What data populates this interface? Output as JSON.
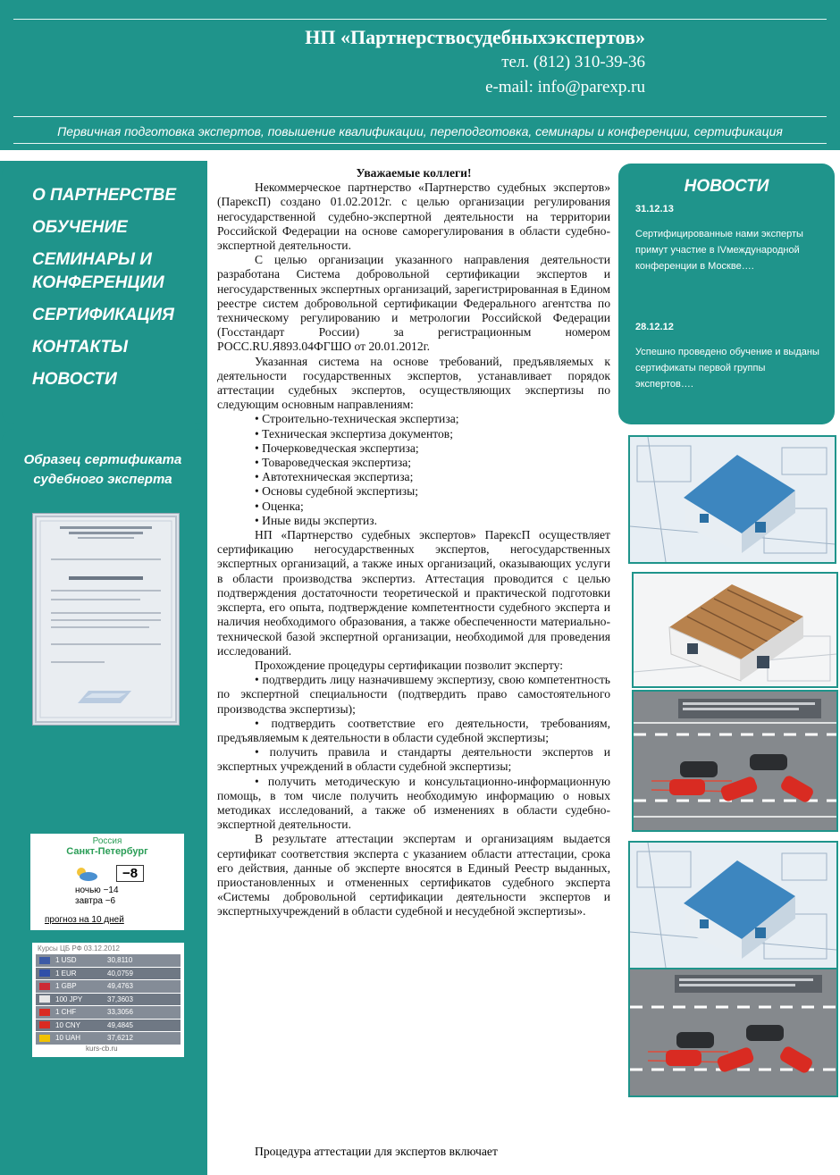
{
  "header": {
    "title": "НП «Партнерствосудебныхэкспертов»",
    "phone": "тел. (812) 310-39-36",
    "email": "e-mail: info@parexp.ru",
    "tagline": "Первичная подготовка экспертов, повышение квалификации, переподготовка, семинары и конференции, сертификация"
  },
  "nav": {
    "items": [
      "О ПАРТНЕРСТВЕ",
      "ОБУЧЕНИЕ",
      "СЕМИНАРЫ И КОНФЕРЕНЦИИ",
      "СЕРТИФИКАЦИЯ",
      "КОНТАКТЫ",
      "НОВОСТИ"
    ]
  },
  "sidebar": {
    "cert_heading": "Образец сертификата судебного эксперта"
  },
  "weather": {
    "country": "Россия",
    "city": "Санкт-Петербург",
    "temp": "−8",
    "night": "ночью −14",
    "tomorrow": "завтра −6",
    "forecast_link": "прогноз на 10 дней"
  },
  "currency": {
    "header": "Курсы ЦБ РФ 03.12.2012",
    "rows": [
      {
        "name": "1 USD",
        "value": "30,8110"
      },
      {
        "name": "1 EUR",
        "value": "40,0759"
      },
      {
        "name": "1 GBP",
        "value": "49,4763"
      },
      {
        "name": "100 JPY",
        "value": "37,3603"
      },
      {
        "name": "1 CHF",
        "value": "33,3056"
      },
      {
        "name": "10 CNY",
        "value": "49,4845"
      },
      {
        "name": "10 UAH",
        "value": "37,6212"
      }
    ],
    "footer": "kurs-cb.ru"
  },
  "content": {
    "greeting": "Уважаемые коллеги!",
    "p1": "Некоммерческое партнерство «Партнерство судебных экспертов» (ПарексП) создано 01.02.2012г. с целью организации регулирования негосударственной судебно-экспертной деятельности на территории Российской Федерации на основе саморегулирования в области судебно-экспертной деятельности.",
    "p2": "С целью организации указанного направления деятельности разработана Система добровольной сертификации экспертов и негосударственных экспертных организаций, зарегистрированная в Едином реестре систем добровольной сертификации Федерального агентства по техническому регулированию и метрологии Российской Федерации (Госстандарт России) за регистрационным номером РОСС.RU.Я893.04ФГШО от 20.01.2012г.",
    "p3": "Указанная система на основе требований, предъявляемых к деятельности государственных экспертов, устанавливает порядок аттестации судебных экспертов, осуществляющих экспертизы по следующим основным направлениям:",
    "areas": [
      "Строительно-техническая экспертиза;",
      "Техническая экспертиза документов;",
      "Почерковедческая экспертиза;",
      "Товароведческая экспертиза;",
      "Автотехническая экспертиза;",
      "Основы судебной экспертизы;",
      "Оценка;",
      "Иные виды экспертиз."
    ],
    "p4": "НП «Партнерство судебных экспертов» ПарексП осуществляет сертификацию негосударственных экспертов, негосударственных экспертных организаций, а также иных организаций, оказывающих услуги в области производства экспертиз. Аттестация проводится с целью подтверждения достаточности теоретической и практической подготовки эксперта, его опыта, подтверждение компетентности судебного эксперта и наличия необходимого образования, а также обеспеченности материально-технической базой экспертной организации, необходимой для проведения исследований.",
    "p5": "Прохождение процедуры сертификации позволит эксперту:",
    "benefits": [
      "• подтвердить лицу назначившему экспертизу, свою компетентность по экспертной специальности (подтвердить право самостоятельного производства экспертизы);",
      "• подтвердить соответствие его деятельности, требованиям, предъявляемым к деятельности в области судебной экспертизы;",
      "• получить правила и стандарты деятельности экспертов и экспертных учреждений в области судебной экспертизы;",
      "• получить методическую и консультационно-информационную помощь, в том числе получить необходимую информацию о новых методиках исследований, а также об изменениях в области судебно-экспертной деятельности."
    ],
    "p6": "В результате аттестации экспертам и организациям выдается сертификат соответствия эксперта с указанием области аттестации, срока его действия, данные об эксперте вносятся в Единый Реестр выданных, приостановленных и отмененных сертификатов судебного эксперта «Системы добровольной сертификации деятельности экспертов и экспертныхучреждений в области судебной и несудебной экспертизы».",
    "tail": "Процедура аттестации для экспертов включает"
  },
  "news": {
    "title": "НОВОСТИ",
    "items": [
      {
        "date": "31.12.13",
        "text": "Сертифицированные нами эксперты примут участие в IVмеждународной конференции в Москве…."
      },
      {
        "date": "28.12.12",
        "text": "Успешно проведено обучение и выданы сертификаты первой группы экспертов…."
      }
    ]
  },
  "colors": {
    "accent": "#1f948b",
    "red_car": "#d92b22",
    "house_blue": "#2a6fa3"
  }
}
